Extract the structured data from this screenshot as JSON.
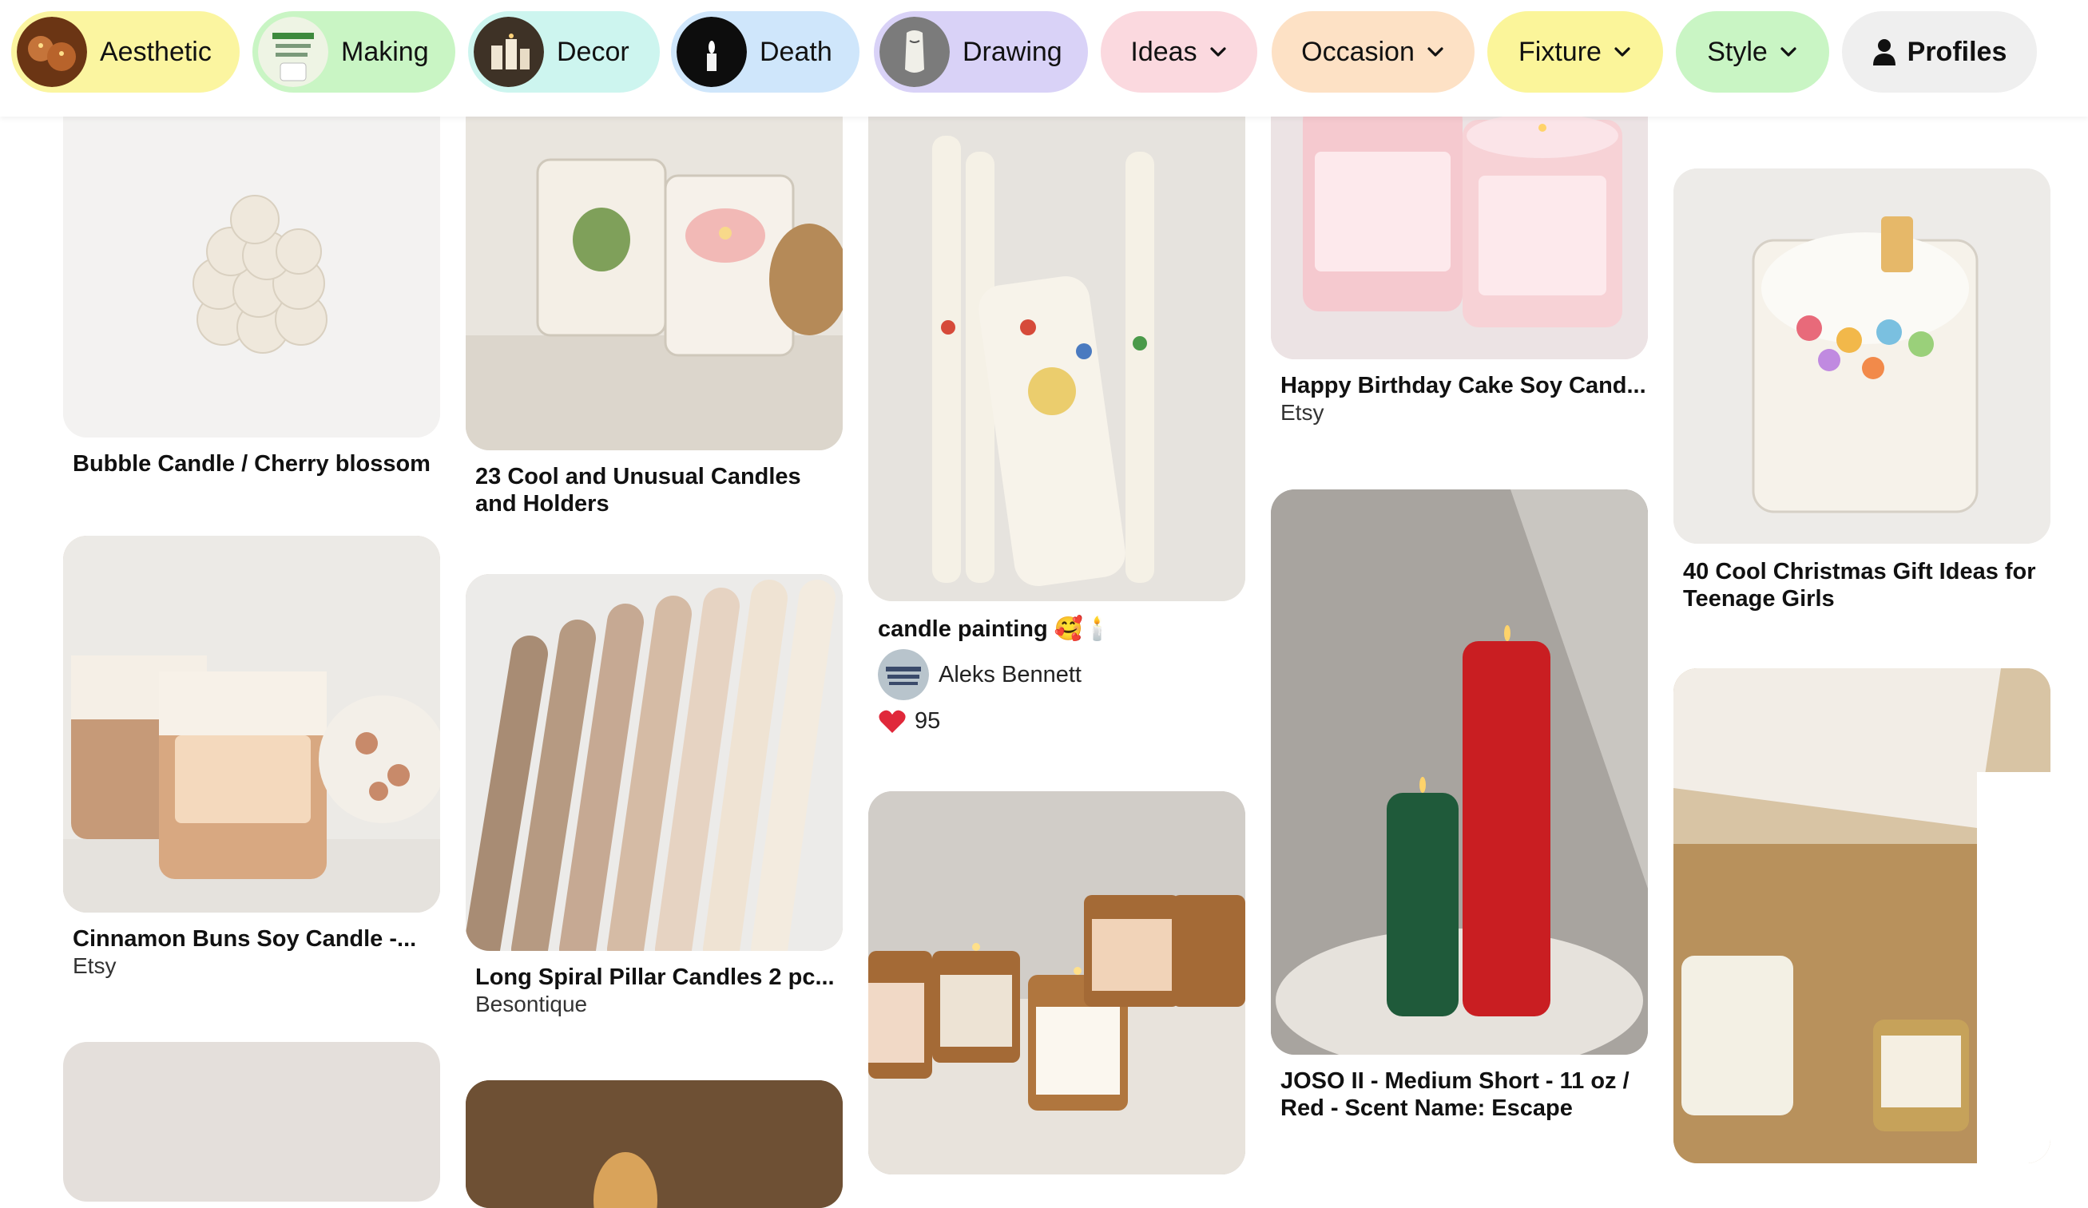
{
  "filters": [
    {
      "label": "Aesthetic",
      "bg": "#fbf5a0",
      "thumb_color": "#8a4a1c",
      "thumb_icon": "candles-thumb"
    },
    {
      "label": "Making",
      "bg": "#c9f5c4",
      "thumb_color": "#d8e8c6",
      "thumb_icon": "making-thumb"
    },
    {
      "label": "Decor",
      "bg": "#cdf5ef",
      "thumb_color": "#5a4a3a",
      "thumb_icon": "decor-thumb"
    },
    {
      "label": "Death",
      "bg": "#cfe6fb",
      "thumb_color": "#101010",
      "thumb_icon": "death-thumb"
    },
    {
      "label": "Drawing",
      "bg": "#d9d2f7",
      "thumb_color": "#8a8a8a",
      "thumb_icon": "drawing-thumb"
    }
  ],
  "dropdowns": [
    {
      "label": "Ideas",
      "bg": "#fbd9df"
    },
    {
      "label": "Occasion",
      "bg": "#fde1c5"
    },
    {
      "label": "Fixture",
      "bg": "#fbf59a"
    },
    {
      "label": "Style",
      "bg": "#c9f5c4"
    }
  ],
  "profiles": {
    "label": "Profiles",
    "bg": "#efefef",
    "icon": "person-icon"
  },
  "pins": {
    "bubble": {
      "title": "Bubble Candle / Cherry blossom",
      "color": "#f1f0ef"
    },
    "cinnamon": {
      "title": "Cinnamon Buns Soy Candle -...",
      "source": "Etsy",
      "color": "#d9c3b2"
    },
    "col1_bottom": {
      "color": "#e4dfdb"
    },
    "cool_unusual": {
      "title": "23 Cool and Unusual Candles and Holders",
      "color": "#e6e1da"
    },
    "spiral": {
      "title": "Long Spiral Pillar Candles 2 pc...",
      "source": "Besontique",
      "color": "#d7c6b6"
    },
    "col2_bottom": {
      "color": "#7b5a3a"
    },
    "painting": {
      "title": "candle painting 🥰🕯️",
      "creator": "Aleks Bennett",
      "reactions": "95",
      "color": "#e9e6e1"
    },
    "selflove": {
      "color": "#cfcbc6"
    },
    "birthday": {
      "title": "Happy Birthday Cake Soy Cand...",
      "source": "Etsy",
      "color": "#f0d7da"
    },
    "joso": {
      "title": "JOSO II - Medium Short - 11 oz / Red - Scent Name: Escape",
      "color": "#a5a29d"
    },
    "cereal": {
      "title": "40 Cool Christmas Gift Ideas for Teenage Girls",
      "color": "#eeece9"
    },
    "giftbox": {
      "color": "#d7c3a4"
    }
  }
}
